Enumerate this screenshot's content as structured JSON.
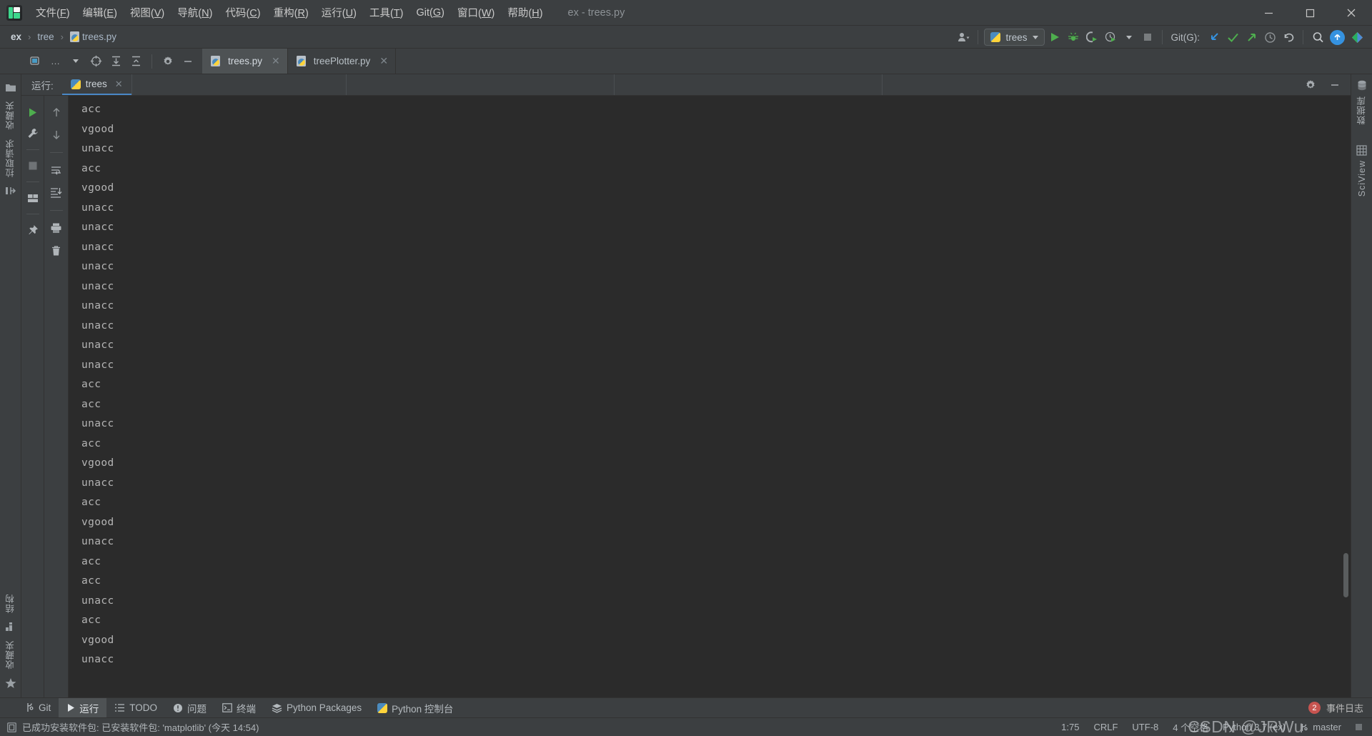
{
  "window": {
    "title": "ex - trees.py",
    "controls": {
      "minimize": "—",
      "maximize": "□",
      "close": "✕"
    }
  },
  "menubar": {
    "logo": "pycharm-logo",
    "items": [
      {
        "label": "文件",
        "mnemonic": "F"
      },
      {
        "label": "编辑",
        "mnemonic": "E"
      },
      {
        "label": "视图",
        "mnemonic": "V"
      },
      {
        "label": "导航",
        "mnemonic": "N"
      },
      {
        "label": "代码",
        "mnemonic": "C"
      },
      {
        "label": "重构",
        "mnemonic": "R"
      },
      {
        "label": "运行",
        "mnemonic": "U"
      },
      {
        "label": "工具",
        "mnemonic": "T"
      },
      {
        "label": "Git",
        "mnemonic": "G"
      },
      {
        "label": "窗口",
        "mnemonic": "W"
      },
      {
        "label": "帮助",
        "mnemonic": "H"
      }
    ]
  },
  "navbar": {
    "breadcrumbs": [
      "ex",
      "tree",
      "trees.py"
    ],
    "separator": "›",
    "run_config": {
      "label": "trees",
      "icon": "python-icon"
    },
    "git_label": "Git(G):",
    "actions": [
      "account-icon",
      "run-icon",
      "debug-icon",
      "coverage-icon",
      "profile-icon",
      "stop-icon",
      "update-project-icon",
      "commit-icon",
      "push-icon",
      "history-icon",
      "rollback-icon",
      "search-icon",
      "notifications-icon",
      "avatar-icon"
    ]
  },
  "editor_tabs": {
    "tools": [
      "project-view-icon",
      "locate-icon",
      "expand-all-icon",
      "collapse-all-icon",
      "settings-icon",
      "hide-icon"
    ],
    "tabs": [
      {
        "label": "trees.py",
        "active": true,
        "icon": "python-file-icon",
        "close": "✕"
      },
      {
        "label": "treePlotter.py",
        "active": false,
        "icon": "python-file-icon",
        "close": "✕"
      }
    ]
  },
  "left_sidebar": {
    "top_label": "项目",
    "items": [
      {
        "label": "收藏夹",
        "icon": "folder-icon"
      },
      {
        "label": "拉取请求",
        "icon": "pull-request-icon"
      },
      {
        "label": "结构",
        "icon": "structure-icon"
      },
      {
        "label": "收藏夹",
        "icon": "star-icon"
      }
    ]
  },
  "right_sidebar": {
    "items": [
      {
        "label": "数据库",
        "icon": "database-icon"
      },
      {
        "label": "SciView",
        "icon": "sciview-icon"
      }
    ]
  },
  "run_panel": {
    "title": "运行:",
    "tab": {
      "label": "trees",
      "icon": "python-icon",
      "close": "✕"
    },
    "settings_icon": "gear-icon",
    "hide_icon": "minimize-icon",
    "tools_left": [
      "rerun-icon",
      "wrench-icon",
      "stop-icon",
      "layout-icon",
      "pin-icon"
    ],
    "tools_right": [
      "up-arrow-icon",
      "down-arrow-icon",
      "soft-wrap-icon",
      "scroll-to-end-icon",
      "print-icon",
      "trash-icon"
    ],
    "output_lines": [
      "acc",
      "vgood",
      "unacc",
      "acc",
      "vgood",
      "unacc",
      "unacc",
      "unacc",
      "unacc",
      "unacc",
      "unacc",
      "unacc",
      "unacc",
      "unacc",
      "acc",
      "acc",
      "unacc",
      "acc",
      "vgood",
      "unacc",
      "acc",
      "vgood",
      "unacc",
      "acc",
      "acc",
      "unacc",
      "acc",
      "vgood",
      "unacc"
    ]
  },
  "bottom_bar": {
    "items": [
      {
        "label": "Git",
        "icon": "git-icon",
        "active": false
      },
      {
        "label": "运行",
        "icon": "run-icon",
        "active": true
      },
      {
        "label": "TODO",
        "icon": "todo-icon",
        "active": false
      },
      {
        "label": "问题",
        "icon": "problems-icon",
        "active": false
      },
      {
        "label": "终端",
        "icon": "terminal-icon",
        "active": false
      },
      {
        "label": "Python Packages",
        "icon": "packages-icon",
        "active": false
      },
      {
        "label": "Python 控制台",
        "icon": "python-console-icon",
        "active": false
      }
    ],
    "event_log": {
      "label": "事件日志",
      "count": "2"
    }
  },
  "status_bar": {
    "message": "已成功安装软件包: 已安装软件包: 'matplotlib' (今天 14:54)",
    "message_icon": "info-icon",
    "caret": "1:75",
    "line_separator": "CRLF",
    "encoding": "UTF-8",
    "indent": "4 个空格",
    "interpreter": "Python 3.7 (ex)",
    "branch": "master",
    "branch_icon": "git-branch-icon",
    "watermark": "CSDN @JRWu"
  },
  "colors": {
    "background": "#3c3f41",
    "console_bg": "#2b2b2b",
    "accent_blue": "#4a88c7",
    "run_green": "#4eae4e",
    "badge_red": "#c75450",
    "text": "#b5b5b5"
  }
}
